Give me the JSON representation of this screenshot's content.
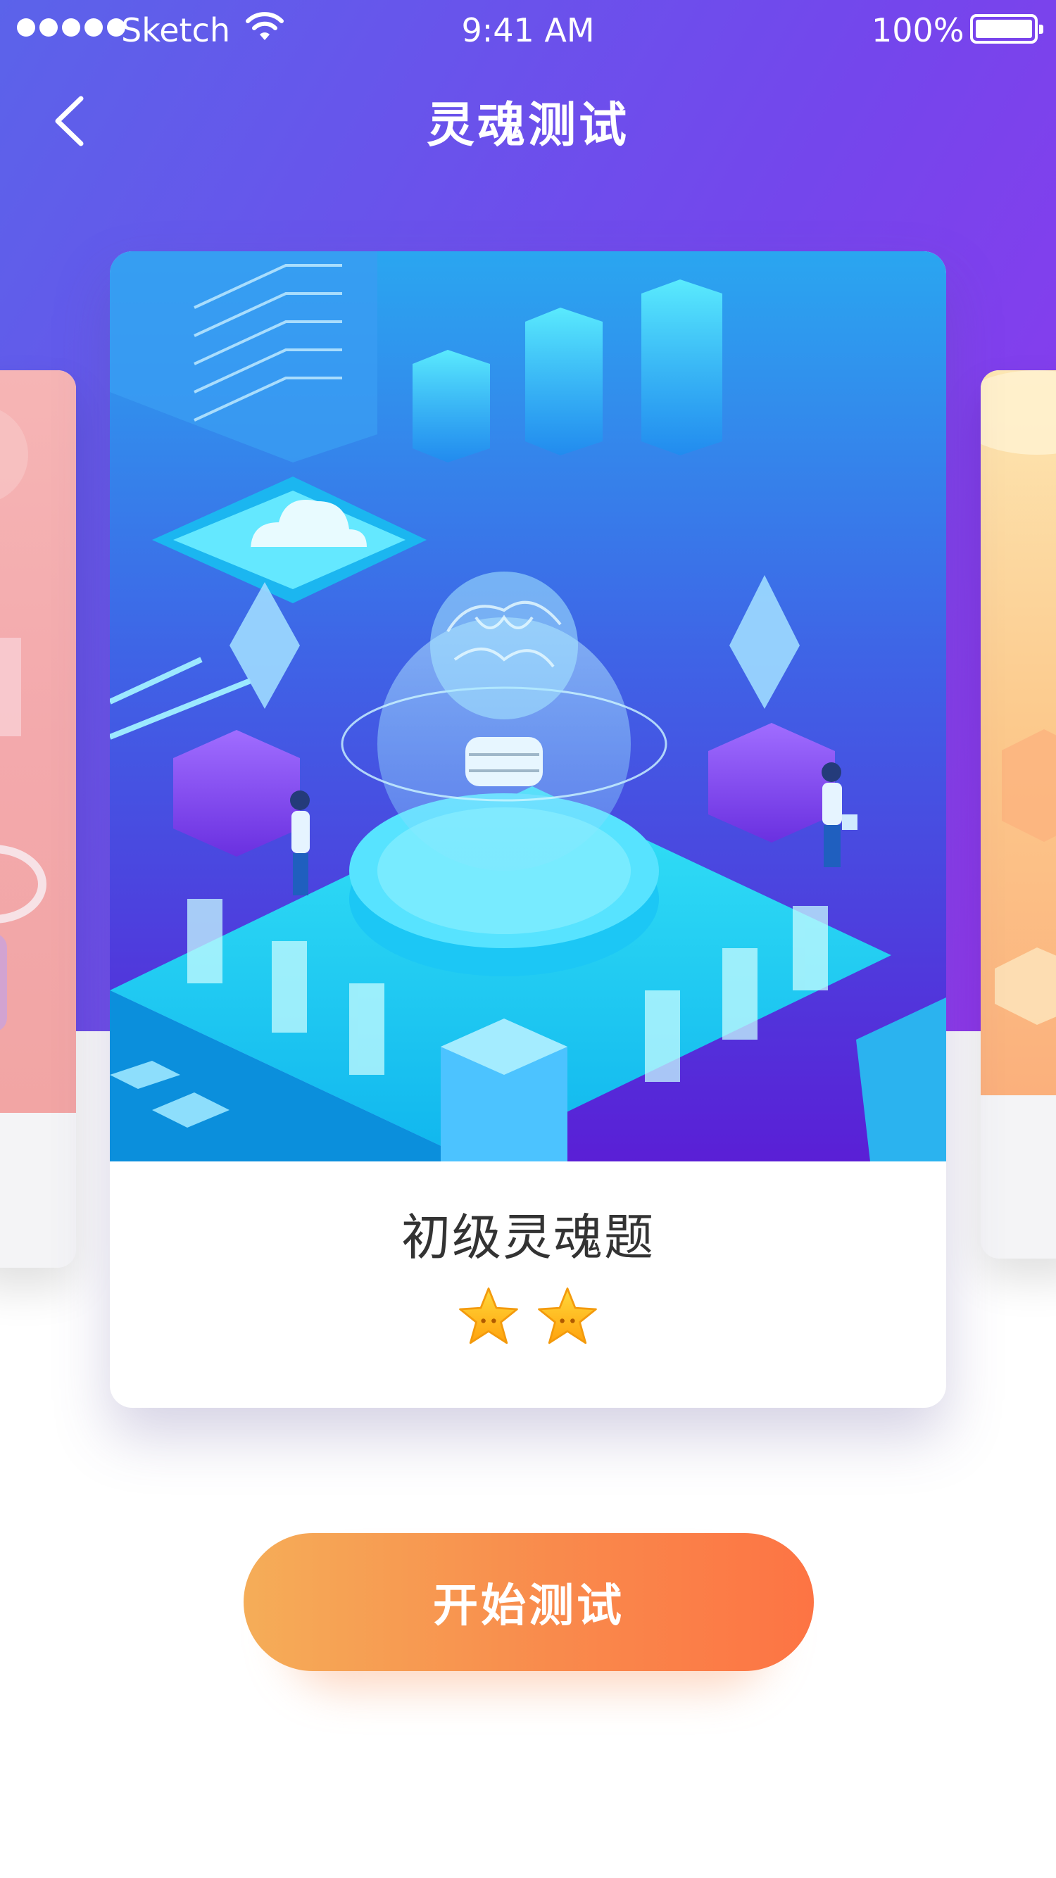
{
  "status_bar": {
    "carrier": "Sketch",
    "time": "9:41 AM",
    "battery": "100%",
    "signal_icon": "signal-dots-icon",
    "wifi_icon": "wifi-icon",
    "battery_icon": "battery-icon"
  },
  "header": {
    "title": "灵魂测试",
    "back_icon": "chevron-left-icon"
  },
  "carousel": {
    "current_card": {
      "title": "初级灵魂题",
      "rating": 2,
      "star_icon": "star-icon",
      "illustration_icon": "isometric-brain-bulb-illustration"
    }
  },
  "actions": {
    "start_label": "开始测试"
  },
  "colors": {
    "header_gradient_start": "#5b63ea",
    "header_gradient_end": "#9336ee",
    "button_gradient_start": "#f5ad58",
    "button_gradient_end": "#fd7444",
    "star": "#ffc21a"
  }
}
